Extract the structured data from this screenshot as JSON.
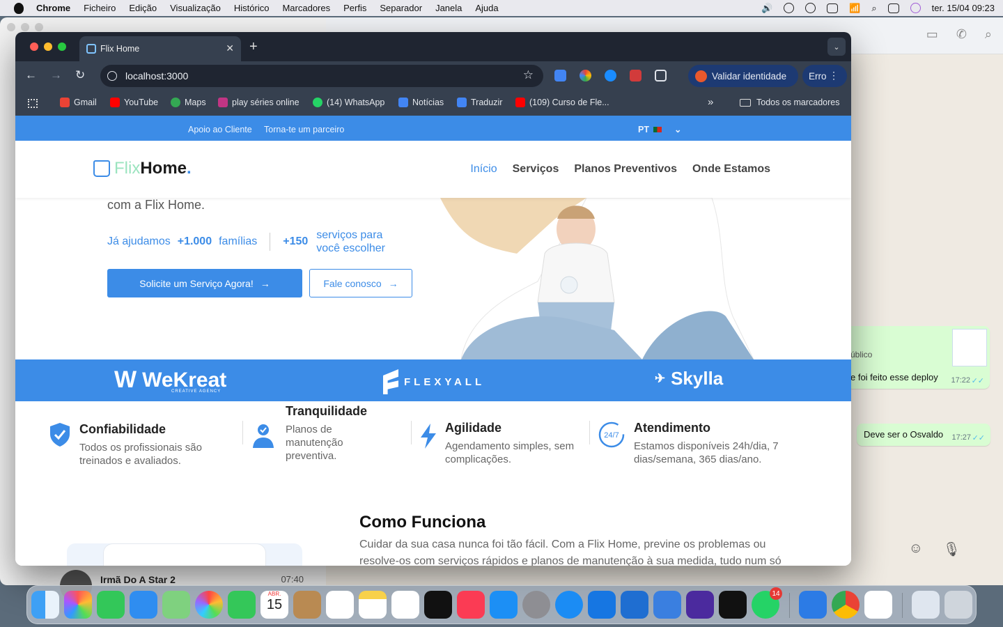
{
  "menubar": {
    "app": "Chrome",
    "items": [
      "Ficheiro",
      "Edição",
      "Visualização",
      "Histórico",
      "Marcadores",
      "Perfis",
      "Separador",
      "Janela",
      "Ajuda"
    ],
    "datetime": "ter. 15/04  09:23"
  },
  "whatsapp": {
    "msg1_text": "e foi feito esse deploy",
    "msg1_partial": "úblico",
    "msg1_time": "17:22",
    "msg2_text": "Deve ser o Osvaldo",
    "msg2_time": "17:27",
    "contact_name": "Irmã Do A Star 2",
    "contact_time": "07:40"
  },
  "browser": {
    "tab_title": "Flix Home",
    "url": "localhost:3000",
    "validar_label": "Validar identidade",
    "erro_label": "Erro",
    "bookmarks": [
      {
        "label": "Gmail",
        "color": "#ea4335"
      },
      {
        "label": "YouTube",
        "color": "#ff0000"
      },
      {
        "label": "Maps",
        "color": "#34a853"
      },
      {
        "label": "play séries online",
        "color": "#c13584"
      },
      {
        "label": "(14) WhatsApp",
        "color": "#25d366"
      },
      {
        "label": "Notícias",
        "color": "#4285f4"
      },
      {
        "label": "Traduzir",
        "color": "#4285f4"
      },
      {
        "label": "(109) Curso de Fle...",
        "color": "#ff0000"
      }
    ],
    "all_bookmarks": "Todos os marcadores"
  },
  "site": {
    "topbar": {
      "support": "Apoio ao Cliente",
      "partner": "Torna-te um parceiro",
      "lang": "PT"
    },
    "logo": {
      "flix": "Flix",
      "home": "Home",
      "dot": "."
    },
    "nav": [
      "Início",
      "Serviços",
      "Planos Preventivos",
      "Onde Estamos"
    ],
    "hero": {
      "subtitle": "com a Flix Home.",
      "stat1_pre": "Já ajudamos",
      "stat1_num": "+1.000",
      "stat1_post": "famílias",
      "stat2_num": "+150",
      "stat2_line1": "serviços para",
      "stat2_line2": "você escolher",
      "cta_primary": "Solicite um Serviço Agora!",
      "cta_secondary": "Fale conosco"
    },
    "partners": [
      {
        "name": "WeKreat",
        "sub": "CREATIVE AGENCY"
      },
      {
        "name": "FLEXYALL"
      },
      {
        "name": "Skylla"
      }
    ],
    "features": [
      {
        "title": "Confiabilidade",
        "desc": "Todos os profissionais são treinados e avaliados."
      },
      {
        "title": "Tranquilidade",
        "desc": "Planos de manutenção preventiva."
      },
      {
        "title": "Agilidade",
        "desc": "Agendamento simples, sem complicações."
      },
      {
        "title": "Atendimento",
        "desc": "Estamos disponíveis 24h/dia, 7 dias/semana, 365 dias/ano.",
        "icon_text": "24/7"
      }
    ],
    "how": {
      "title": "Como Funciona",
      "desc": "Cuidar da sua casa nunca foi tão fácil. Com a Flix Home, previne os problemas ou resolve-os com serviços rápidos e planos de manutenção à sua medida, tudo num só clique."
    }
  },
  "dock": {
    "whatsapp_badge": "14",
    "calendar_month": "ABR.",
    "calendar_day": "15"
  }
}
